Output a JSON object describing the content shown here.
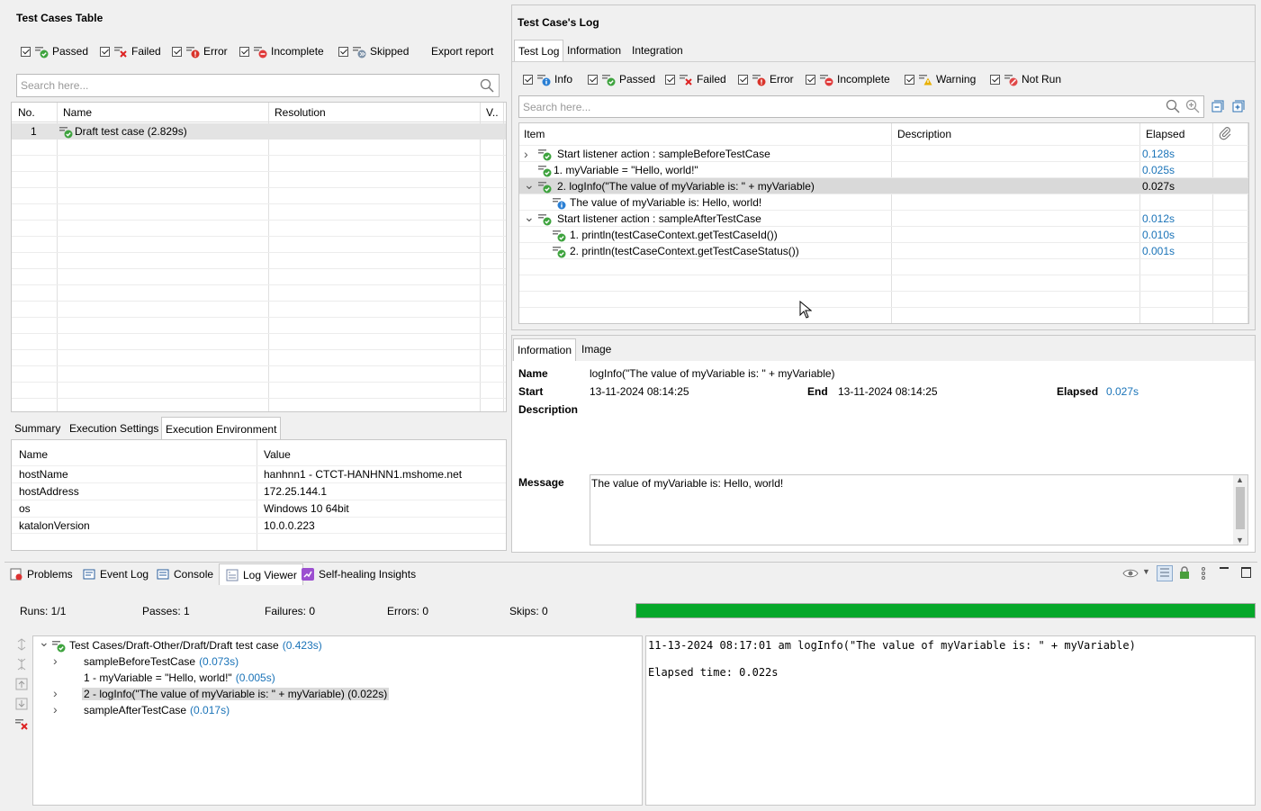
{
  "test_cases_table": {
    "title": "Test Cases Table",
    "filters": [
      {
        "label": "Passed",
        "icon": "passed-icon"
      },
      {
        "label": "Failed",
        "icon": "failed-icon"
      },
      {
        "label": "Error",
        "icon": "error-icon"
      },
      {
        "label": "Incomplete",
        "icon": "incomplete-icon"
      },
      {
        "label": "Skipped",
        "icon": "skipped-icon"
      }
    ],
    "export_label": "Export report",
    "search_placeholder": "Search here...",
    "columns": [
      "No.",
      "Name",
      "Resolution",
      "V.."
    ],
    "rows": [
      {
        "no": "1",
        "name": "Draft test case (2.829s)",
        "resolution": "",
        "v": ""
      }
    ]
  },
  "bottom_left_tabs": {
    "tabs": [
      "Summary",
      "Execution Settings",
      "Execution Environment"
    ],
    "active": "Execution Environment",
    "columns": [
      "Name",
      "Value"
    ],
    "rows": [
      {
        "name": "hostName",
        "value": "hanhnn1 - CTCT-HANHNN1.mshome.net"
      },
      {
        "name": "hostAddress",
        "value": "172.25.144.1"
      },
      {
        "name": "os",
        "value": "Windows 10 64bit"
      },
      {
        "name": "katalonVersion",
        "value": "10.0.0.223"
      }
    ]
  },
  "test_case_log": {
    "title": "Test Case's Log",
    "tabs": [
      "Test Log",
      "Information",
      "Integration"
    ],
    "filters": [
      {
        "label": "Info",
        "icon": "info-icon"
      },
      {
        "label": "Passed",
        "icon": "passed-icon"
      },
      {
        "label": "Failed",
        "icon": "failed-icon"
      },
      {
        "label": "Error",
        "icon": "error-icon"
      },
      {
        "label": "Incomplete",
        "icon": "incomplete-icon"
      },
      {
        "label": "Warning",
        "icon": "warning-icon"
      },
      {
        "label": "Not Run",
        "icon": "not-run-icon"
      }
    ],
    "search_placeholder": "Search here...",
    "columns": [
      "Item",
      "Description",
      "Elapsed"
    ],
    "rows": [
      {
        "item": "Start listener action : sampleBeforeTestCase",
        "elapsed": "0.128s",
        "indent": 0,
        "chev": "right",
        "icon": "passed-icon"
      },
      {
        "item": "1. myVariable = \"Hello, world!\"",
        "elapsed": "0.025s",
        "indent": 0,
        "chev": "",
        "icon": "passed-icon"
      },
      {
        "item": "2. logInfo(\"The value of myVariable is: \" + myVariable)",
        "elapsed": "0.027s",
        "indent": 0,
        "chev": "down",
        "icon": "passed-icon",
        "selected": true
      },
      {
        "item": "The value of myVariable is: Hello, world!",
        "elapsed": "",
        "indent": 1,
        "chev": "",
        "icon": "info-icon"
      },
      {
        "item": "Start listener action : sampleAfterTestCase",
        "elapsed": "0.012s",
        "indent": 0,
        "chev": "down",
        "icon": "passed-icon"
      },
      {
        "item": "1. println(testCaseContext.getTestCaseId())",
        "elapsed": "0.010s",
        "indent": 1,
        "chev": "",
        "icon": "passed-icon"
      },
      {
        "item": "2. println(testCaseContext.getTestCaseStatus())",
        "elapsed": "0.001s",
        "indent": 1,
        "chev": "",
        "icon": "passed-icon"
      }
    ]
  },
  "info_panel": {
    "tabs": [
      "Information",
      "Image"
    ],
    "name_label": "Name",
    "name_value": "logInfo(\"The value of myVariable is: \" + myVariable)",
    "start_label": "Start",
    "start_value": "13-11-2024 08:14:25",
    "end_label": "End",
    "end_value": "13-11-2024 08:14:25",
    "elapsed_label": "Elapsed",
    "elapsed_value": "0.027s",
    "description_label": "Description",
    "message_label": "Message",
    "message_value": "The value of myVariable is: Hello, world!"
  },
  "bottom_views": {
    "tabs": [
      {
        "label": "Problems",
        "icon": "problems-icon"
      },
      {
        "label": "Event Log",
        "icon": "event-log-icon"
      },
      {
        "label": "Console",
        "icon": "console-icon"
      },
      {
        "label": "Log Viewer",
        "icon": "log-viewer-icon"
      },
      {
        "label": "Self-healing Insights",
        "icon": "self-healing-icon"
      }
    ],
    "active": "Log Viewer"
  },
  "log_viewer": {
    "runs": "Runs: 1/1",
    "passes": "Passes: 1",
    "failures": "Failures: 0",
    "errors": "Errors: 0",
    "skips": "Skips: 0",
    "progress": 1.0,
    "progress_color": "#06a82a",
    "tree": [
      {
        "label": "Test Cases/Draft-Other/Draft/Draft test case",
        "time": "(0.423s)",
        "level": 0,
        "chev": "down",
        "icon": "passed-icon"
      },
      {
        "label": "sampleBeforeTestCase",
        "time": "(0.073s)",
        "level": 1,
        "chev": "right",
        "icon": ""
      },
      {
        "label": "1 - myVariable = \"Hello, world!\"",
        "time": "(0.005s)",
        "level": 1,
        "chev": "",
        "icon": ""
      },
      {
        "label": "2 - logInfo(\"The value of myVariable is: \" + myVariable) (0.022s)",
        "time": "",
        "level": 1,
        "chev": "right",
        "icon": "",
        "selected": true
      },
      {
        "label": "sampleAfterTestCase",
        "time": "(0.017s)",
        "level": 1,
        "chev": "right",
        "icon": ""
      }
    ],
    "detail_line1": "11-13-2024 08:17:01 am logInfo(\"The value of myVariable is: \" + myVariable)",
    "detail_line2": "Elapsed time: 0.022s"
  }
}
